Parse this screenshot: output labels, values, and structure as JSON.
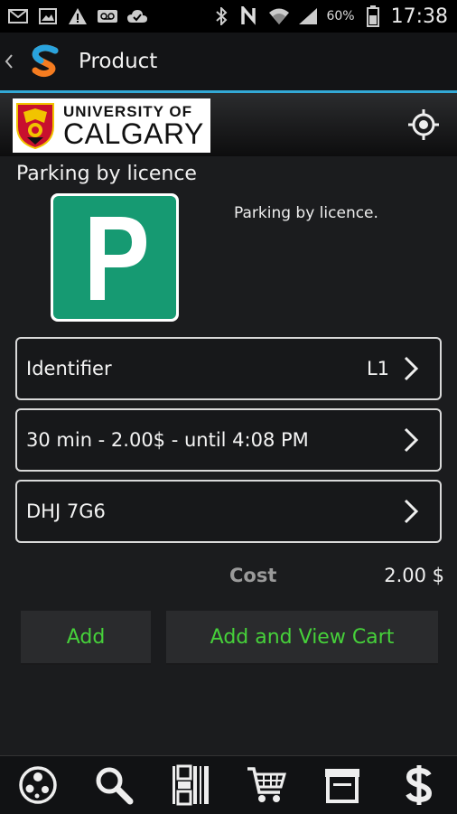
{
  "status_bar": {
    "battery": "60%",
    "time": "17:38",
    "icons": [
      "mail-icon",
      "image-icon",
      "warning-icon",
      "voicemail-icon",
      "cloud-check-icon",
      "bluetooth-icon",
      "n-icon",
      "wifi-icon",
      "signal-icon",
      "battery-icon"
    ]
  },
  "action_bar": {
    "title": "Product"
  },
  "banner": {
    "logo_line1": "UNIVERSITY OF",
    "logo_line2": "CALGARY"
  },
  "product": {
    "name": "Parking by licence",
    "description": "Parking by licence.",
    "image_letter": "P",
    "image_color": "#169a72"
  },
  "rows": [
    {
      "label": "Identifier",
      "value": "L1"
    },
    {
      "label": "30 min - 2.00$ - until 4:08 PM",
      "value": ""
    },
    {
      "label": "DHJ 7G6",
      "value": ""
    }
  ],
  "cost": {
    "label": "Cost",
    "value": "2.00 $"
  },
  "buttons": {
    "add": "Add",
    "add_view_cart": "Add and View Cart"
  },
  "bottom_nav": [
    "globe-icon",
    "search-icon",
    "barcode-icon",
    "cart-icon",
    "store-icon",
    "dollar-icon"
  ],
  "colors": {
    "accent": "#33a9d6",
    "button_text": "#46d13a"
  }
}
